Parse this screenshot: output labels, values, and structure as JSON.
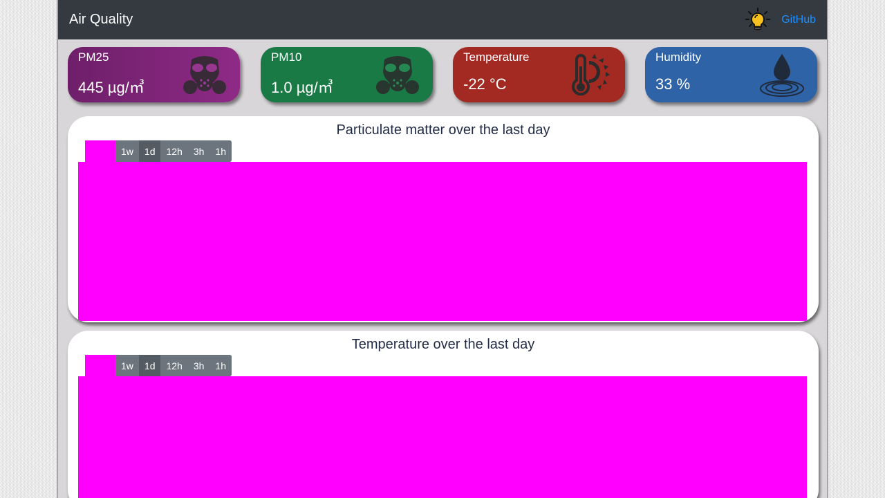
{
  "navbar": {
    "brand": "Air Quality",
    "theme_toggle_icon": "lightbulb-icon",
    "github_label": "GitHub"
  },
  "cards": [
    {
      "title": "PM25",
      "value": "445 µg/㎥",
      "icon": "gas-mask-icon",
      "color": "#7e2478"
    },
    {
      "title": "PM10",
      "value": "1.0 µg/㎥",
      "icon": "gas-mask-icon",
      "color": "#1a7a45"
    },
    {
      "title": "Temperature",
      "value": "-22 °C",
      "icon": "thermometer-sun-icon",
      "color": "#a32a22"
    },
    {
      "title": "Humidity",
      "value": "33 %",
      "icon": "water-drop-icon",
      "color": "#2f63a8"
    }
  ],
  "charts": [
    {
      "title": "Particulate matter over the last day",
      "ranges": [
        "1w",
        "1d",
        "12h",
        "3h",
        "1h"
      ],
      "active_range": "1d",
      "placeholder_color": "#ff00ff"
    },
    {
      "title": "Temperature over the last day",
      "ranges": [
        "1w",
        "1d",
        "12h",
        "3h",
        "1h"
      ],
      "active_range": "1d",
      "placeholder_color": "#ff00ff"
    }
  ],
  "colors": {
    "navbar": "#343a40",
    "link": "#1e90ff",
    "range_button": "#6c757d",
    "range_button_active": "#545b62"
  }
}
